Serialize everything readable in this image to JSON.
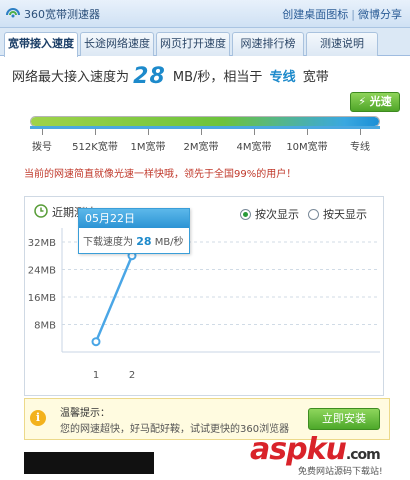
{
  "window": {
    "title": "360宽带测速器",
    "links": [
      "创建桌面图标",
      "微博分享"
    ]
  },
  "tabs": [
    {
      "label": "宽带接入速度",
      "active": true
    },
    {
      "label": "长途网络速度",
      "active": false
    },
    {
      "label": "网页打开速度",
      "active": false
    },
    {
      "label": "网速排行榜",
      "active": false
    },
    {
      "label": "测速说明",
      "active": false
    }
  ],
  "headline": {
    "prefix": "网络最大接入速度为",
    "speed": "28",
    "unit": "MB/秒，相当于",
    "level": "专线",
    "suffix": "宽带"
  },
  "fiber_button": {
    "label": "光速",
    "icon": "lightning-icon"
  },
  "speed_scale": {
    "fill_percent": 100,
    "labels": [
      "拨号",
      "512K宽带",
      "1M宽带",
      "2M宽带",
      "4M宽带",
      "10M宽带",
      "专线"
    ]
  },
  "comparison_text": "当前的网速简直就像光速一样快哦，领先于全国99%的用户！",
  "chart_data": {
    "type": "line",
    "title": "近期测速",
    "x": [
      1,
      2
    ],
    "series": [
      {
        "values": [
          3,
          28
        ]
      }
    ],
    "ylim": [
      0,
      32
    ],
    "yticks": [
      "8MB",
      "16MB",
      "24MB",
      "32MB"
    ],
    "xticks": [
      "1",
      "2"
    ],
    "grid": "horizontal-dashed"
  },
  "display_options": [
    {
      "label": "按次显示",
      "selected": true
    },
    {
      "label": "按天显示",
      "selected": false
    }
  ],
  "tooltip": {
    "date": "05月22日",
    "prefix": "下载速度为",
    "value": "28",
    "unit": "MB/秒"
  },
  "notice": {
    "title": "温馨提示：",
    "text": "您的网速超快，好马配好鞍，试试更快的360浏览器",
    "button_label": "立即安装"
  },
  "watermark": {
    "brand": "aspku",
    "tld": ".com",
    "tagline": "免费网站源码下载站!"
  },
  "colors": {
    "accent_blue": "#1d8acb",
    "green_button": "#4fa528",
    "red_text": "#c0392b"
  }
}
